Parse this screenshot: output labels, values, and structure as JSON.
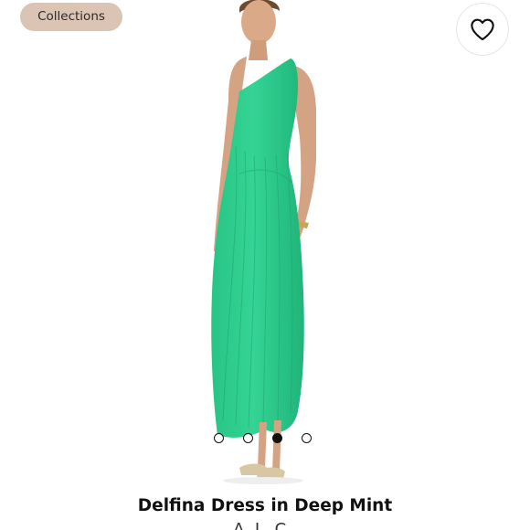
{
  "header": {
    "collections_label": "Collections",
    "favorite_icon": "heart-outline-icon"
  },
  "gallery": {
    "image_subject": "model wearing one-shoulder pleated green maxi dress",
    "dress_color": "#2fcf8f",
    "slide_count": 4,
    "active_slide": 3
  },
  "product": {
    "title": "Delfina Dress in Deep Mint",
    "brand": "A.L.C."
  }
}
